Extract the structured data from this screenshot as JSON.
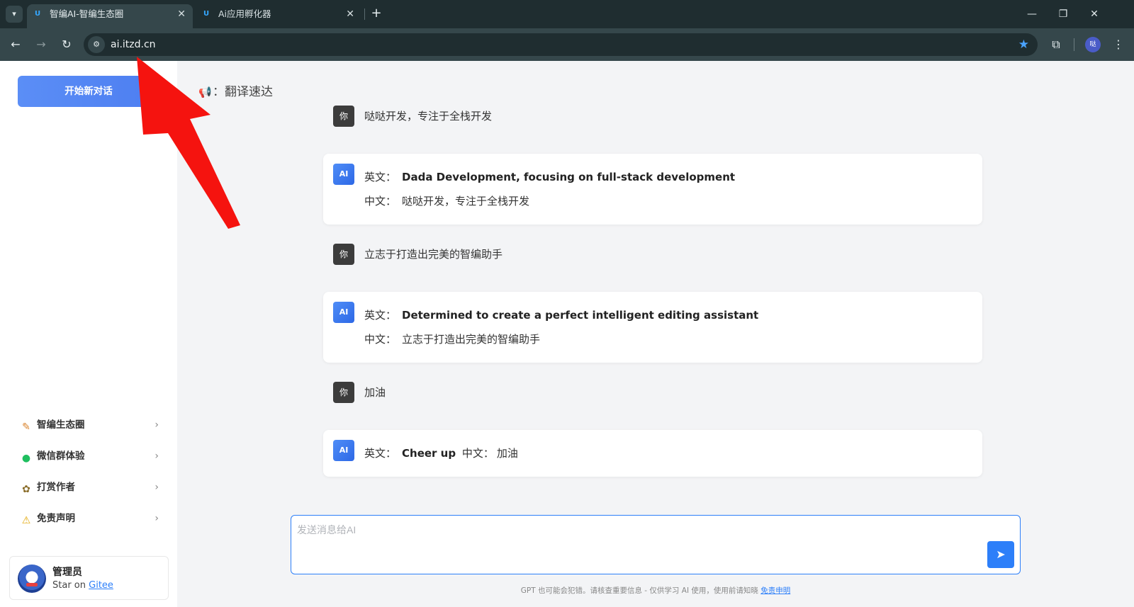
{
  "browser": {
    "tabs": [
      {
        "title": "智编AI-智编生态圈",
        "active": true
      },
      {
        "title": "Ai应用孵化器",
        "active": false
      }
    ],
    "favicon_text": "U",
    "close_glyph": "✕",
    "new_tab_glyph": "+",
    "url": "ai.itzd.cn",
    "profile_initial": "哒",
    "accent_color": "#4aa3ff"
  },
  "sidebar": {
    "new_chat_label": "开始新对话",
    "menu": [
      {
        "label": "智编生态圈",
        "icon": "pencil-icon"
      },
      {
        "label": "微信群体验",
        "icon": "wechat-icon"
      },
      {
        "label": "打赏作者",
        "icon": "gift-icon"
      },
      {
        "label": "免责声明",
        "icon": "warning-icon"
      }
    ],
    "user": {
      "name": "管理员",
      "star_prefix": "Star on",
      "star_link": "Gitee"
    }
  },
  "main": {
    "topic_sep": "：",
    "topic": "翻译速达",
    "user_avatar": "你",
    "ai_avatar": "AI",
    "en_label": "英文：",
    "zh_label": "中文：",
    "messages": [
      {
        "user": "哒哒开发，专注于全栈开发",
        "en": "Dada Development, focusing on full-stack development",
        "zh": "哒哒开发，专注于全栈开发"
      },
      {
        "user": "立志于打造出完美的智编助手",
        "en": "Determined to create a perfect intelligent editing assistant",
        "zh": "立志于打造出完美的智编助手"
      },
      {
        "user": "加油",
        "en": "Cheer up",
        "zh": "加油"
      }
    ],
    "composer_placeholder": "发送消息给AI",
    "disclaimer_text": "GPT 也可能会犯错。请核查重要信息 - 仅供学习 AI 使用，使用前请知晓",
    "disclaimer_link": "免责申明"
  },
  "colors": {
    "primary": "#2d7ff9",
    "annotation_arrow": "#f5130f"
  }
}
